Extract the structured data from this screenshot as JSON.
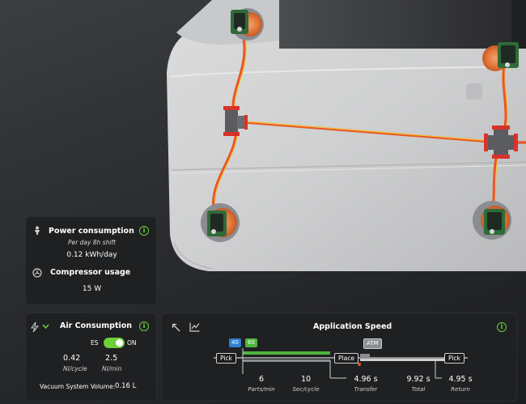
{
  "colors": {
    "accent_green": "#6ecf3a",
    "badge_blue": "#2f7fd1",
    "badge_green": "#4fb63a",
    "badge_gray": "#8a8d92",
    "hose_orange": "#e8572a",
    "hose_yellow": "#f2c230",
    "card_bg": "#1f2022"
  },
  "power": {
    "title": "Power consumption",
    "subtitle": "Per day 8h shift",
    "value": "0.12 kWh/day",
    "compressor_title": "Compressor usage",
    "compressor_value": "15 W",
    "icons": [
      "person-icon",
      "fan-icon",
      "info-icon"
    ]
  },
  "air": {
    "title": "Air Consumption",
    "toggle_left": "ES",
    "toggle_right": "ON",
    "toggle_state": "on",
    "val1": "0.42",
    "unit1": "Nl/cycle",
    "val2": "2.5",
    "unit2": "Nl/min",
    "vacuum_label": "Vacuum System Volume:",
    "vacuum_value": "0.16 L",
    "icons": [
      "bolt-icon",
      "chevron-down-icon",
      "info-icon"
    ]
  },
  "speed": {
    "title": "Application Speed",
    "badge_blue": "40",
    "badge_green": "60",
    "badge_atm": "ATM",
    "pick1": "Pick",
    "place": "Place",
    "pick2": "Pick",
    "stats": [
      {
        "value": "6",
        "label": "Parts/min"
      },
      {
        "value": "10",
        "label": "Sec/cycle"
      },
      {
        "value": "4.96 s",
        "label": "Transfer"
      },
      {
        "value": "9.92 s",
        "label": "Total"
      },
      {
        "value": "4.95 s",
        "label": "Return"
      }
    ],
    "icons": [
      "collapse-arrow-icon",
      "chart-icon",
      "info-icon"
    ]
  }
}
